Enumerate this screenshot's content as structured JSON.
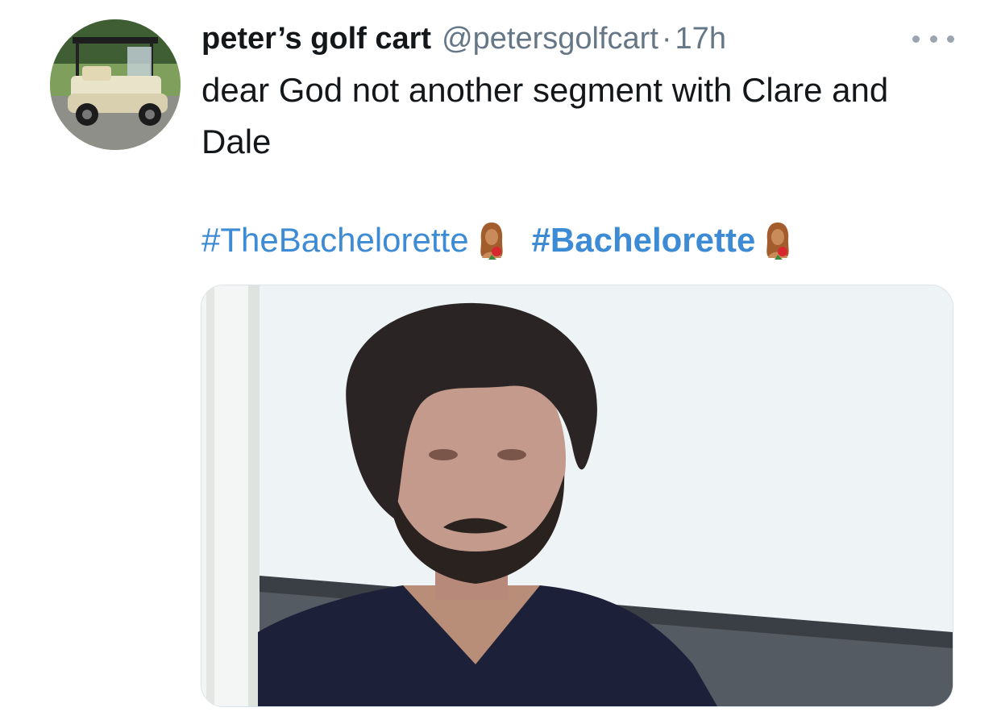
{
  "tweet": {
    "display_name": "peter’s golf cart",
    "handle": "@petersgolfcart",
    "separator": "·",
    "timestamp": "17h",
    "text": "dear God not another segment with Clare and Dale",
    "hashtags": [
      {
        "label": "#TheBachelorette",
        "bold": false,
        "icon": "bachelorette-emoji-icon"
      },
      {
        "label": "#Bachelorette",
        "bold": true,
        "icon": "bachelorette-emoji-icon"
      }
    ],
    "avatar_icon": "golf-cart-avatar",
    "more_icon": "more-options-icon",
    "media_icon": "man-in-dark-sweater-photo"
  },
  "colors": {
    "link": "#3d8bd4",
    "text": "#14171a",
    "secondary": "#657786",
    "border": "#dbe2e8"
  }
}
